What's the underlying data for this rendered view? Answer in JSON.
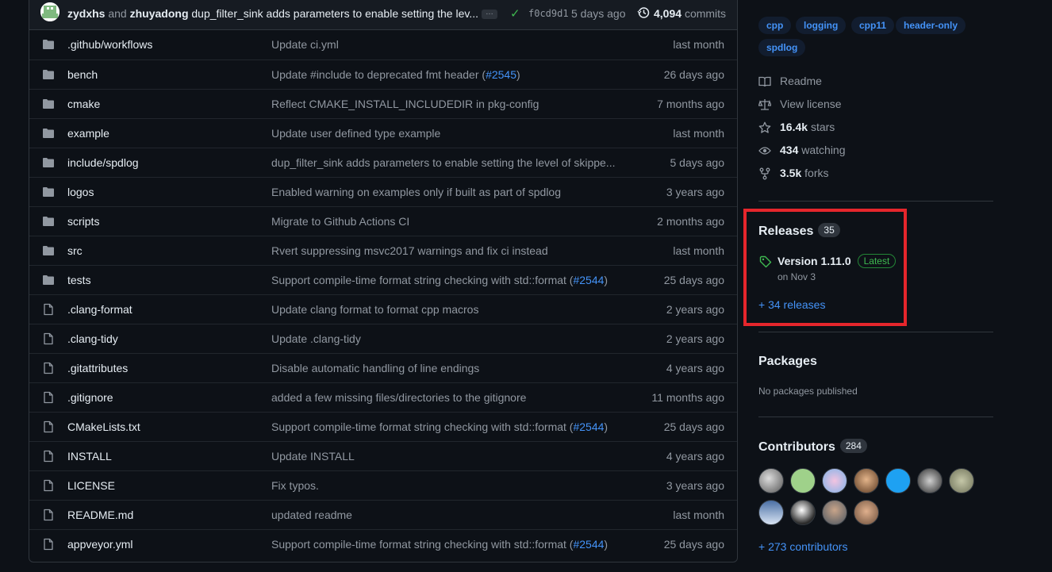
{
  "latest_commit": {
    "author1": "zydxhs",
    "and_text": "and",
    "author2": "zhuyadong",
    "message": "dup_filter_sink adds parameters to enable setting the lev...",
    "ellipsis": "…",
    "sha": "f0cd9d1",
    "time": "5 days ago",
    "count": "4,094",
    "count_label": "commits"
  },
  "files": [
    {
      "type": "dir",
      "name": ".github/workflows",
      "msg": "Update ci.yml",
      "time": "last month"
    },
    {
      "type": "dir",
      "name": "bench",
      "msg_pre": "Update #include to deprecated fmt header (",
      "link": "#2545",
      "msg_post": ")",
      "time": "26 days ago"
    },
    {
      "type": "dir",
      "name": "cmake",
      "msg": "Reflect CMAKE_INSTALL_INCLUDEDIR in pkg-config",
      "time": "7 months ago"
    },
    {
      "type": "dir",
      "name": "example",
      "msg": "Update user defined type example",
      "time": "last month"
    },
    {
      "type": "dir",
      "name": "include/spdlog",
      "msg": "dup_filter_sink adds parameters to enable setting the level of skippe...",
      "time": "5 days ago"
    },
    {
      "type": "dir",
      "name": "logos",
      "msg": "Enabled warning on examples only if built as part of spdlog",
      "time": "3 years ago"
    },
    {
      "type": "dir",
      "name": "scripts",
      "msg": "Migrate to Github Actions CI",
      "time": "2 months ago"
    },
    {
      "type": "dir",
      "name": "src",
      "msg": "Rvert suppressing msvc2017 warnings and fix ci instead",
      "time": "last month"
    },
    {
      "type": "dir",
      "name": "tests",
      "msg_pre": "Support compile-time format string checking with std::format (",
      "link": "#2544",
      "msg_post": ")",
      "time": "25 days ago"
    },
    {
      "type": "file",
      "name": ".clang-format",
      "msg": "Update clang format to format cpp macros",
      "time": "2 years ago"
    },
    {
      "type": "file",
      "name": ".clang-tidy",
      "msg": "Update .clang-tidy",
      "time": "2 years ago"
    },
    {
      "type": "file",
      "name": ".gitattributes",
      "msg": "Disable automatic handling of line endings",
      "time": "4 years ago"
    },
    {
      "type": "file",
      "name": ".gitignore",
      "msg": "added a few missing files/directories to the gitignore",
      "time": "11 months ago"
    },
    {
      "type": "file",
      "name": "CMakeLists.txt",
      "msg_pre": "Support compile-time format string checking with std::format (",
      "link": "#2544",
      "msg_post": ")",
      "time": "25 days ago"
    },
    {
      "type": "file",
      "name": "INSTALL",
      "msg": "Update INSTALL",
      "time": "4 years ago"
    },
    {
      "type": "file",
      "name": "LICENSE",
      "msg": "Fix typos.",
      "time": "3 years ago"
    },
    {
      "type": "file",
      "name": "README.md",
      "msg": "updated readme",
      "time": "last month"
    },
    {
      "type": "file",
      "name": "appveyor.yml",
      "msg_pre": "Support compile-time format string checking with std::format (",
      "link": "#2544",
      "msg_post": ")",
      "time": "25 days ago"
    }
  ],
  "sidebar": {
    "topics": [
      "cpp",
      "logging",
      "cpp11",
      "header-only",
      "spdlog"
    ],
    "readme": "Readme",
    "license": "View license",
    "stars_value": "16.4k",
    "stars_label": "stars",
    "watching_value": "434",
    "watching_label": "watching",
    "forks_value": "3.5k",
    "forks_label": "forks",
    "releases": {
      "title": "Releases",
      "count": "35",
      "latest_name": "Version 1.11.0",
      "latest_badge": "Latest",
      "latest_date": "on Nov 3",
      "more": "+ 34 releases"
    },
    "packages": {
      "title": "Packages",
      "empty": "No packages published"
    },
    "contributors": {
      "title": "Contributors",
      "count": "284",
      "more": "+ 273 contributors"
    }
  },
  "colors": {
    "highlight": "#e5262c",
    "accent": "#4493f8",
    "success": "#3fb950"
  }
}
